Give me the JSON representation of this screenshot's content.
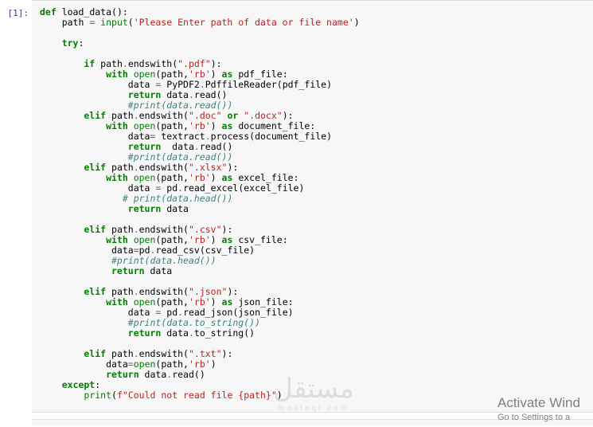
{
  "prompt": "[1]:",
  "code": {
    "l1_def": "def",
    "l1_name": " load_data",
    "l1_paren": "():",
    "l2_name": "    path ",
    "l2_eq": "=",
    "l2_input": " input",
    "l2_paren_o": "(",
    "l2_str": "'Please Enter path of data or file name'",
    "l2_paren_c": ")",
    "l4_try": "    try",
    "l4_colon": ":",
    "l6_if": "        if",
    "l6_cond": " path",
    "l6_dot": ".",
    "l6_ew": "endswith",
    "l6_po": "(",
    "l6_str": "\".pdf\"",
    "l6_pc": "):",
    "l7_with": "            with",
    "l7_open": " open",
    "l7_po": "(",
    "l7_arg1": "path,",
    "l7_str": "'rb'",
    "l7_pc": ")",
    "l7_as": " as",
    "l7_var": " pdf_file:",
    "l8_assign": "                data ",
    "l8_eq": "=",
    "l8_rhs": " PyPDF2",
    "l8_dot1": ".",
    "l8_rhs2": "PdffileReader",
    "l8_po": "(",
    "l8_arg": "pdf_file",
    "l8_pc": ")",
    "l9_ret": "                return",
    "l9_exp": " data",
    "l9_dot": ".",
    "l9_read": "read",
    "l9_par": "()",
    "l10_cm": "                #print(data.read())",
    "l11_elif": "        elif",
    "l11_cond": " path",
    "l11_dot": ".",
    "l11_ew": "endswith",
    "l11_po": "(",
    "l11_str1": "\".doc\"",
    "l11_or": " or ",
    "l11_str2": "\".docx\"",
    "l11_pc": "):",
    "l12_with": "            with",
    "l12_open": " open",
    "l12_po": "(",
    "l12_arg1": "path,",
    "l12_str": "'rb'",
    "l12_pc": ")",
    "l12_as": " as",
    "l12_var": " document_file:",
    "l13_assign": "                data",
    "l13_eq": "=",
    "l13_rhs": " textract",
    "l13_dot": ".",
    "l13_proc": "process",
    "l13_po": "(",
    "l13_arg": "document_file",
    "l13_pc": ")",
    "l14_ret": "                return",
    "l14_exp": "  data",
    "l14_dot": ".",
    "l14_read": "read",
    "l14_par": "()",
    "l15_cm": "                #print(data.read())",
    "l16_elif": "        elif",
    "l16_cond": " path",
    "l16_dot": ".",
    "l16_ew": "endswith",
    "l16_po": "(",
    "l16_str": "\".xlsx\"",
    "l16_pc": "):",
    "l17_with": "            with",
    "l17_open": " open",
    "l17_po": "(",
    "l17_arg1": "path,",
    "l17_str": "'rb'",
    "l17_pc": ")",
    "l17_as": " as",
    "l17_var": " excel_file:",
    "l18_assign": "                data ",
    "l18_eq": "=",
    "l18_rhs": " pd",
    "l18_dot": ".",
    "l18_fn": "read_excel",
    "l18_po": "(",
    "l18_arg": "excel_file",
    "l18_pc": ")",
    "l19_cm": "               # print(data.head())",
    "l20_ret": "                return",
    "l20_exp": " data",
    "l22_elif": "        elif",
    "l22_cond": " path",
    "l22_dot": ".",
    "l22_ew": "endswith",
    "l22_po": "(",
    "l22_str": "\".csv\"",
    "l22_pc": "):",
    "l23_with": "            with",
    "l23_open": " open",
    "l23_po": "(",
    "l23_arg1": "path,",
    "l23_str": "'rb'",
    "l23_pc": ")",
    "l23_as": " as",
    "l23_var": " csv_file:",
    "l24_assign": "             data",
    "l24_eq": "=",
    "l24_rhs": "pd",
    "l24_dot": ".",
    "l24_fn": "read_csv",
    "l24_po": "(",
    "l24_arg": "csv_file",
    "l24_pc": ")",
    "l25_cm": "             #print(data.head())",
    "l26_ret": "             return",
    "l26_exp": " data",
    "l28_elif": "        elif",
    "l28_cond": " path",
    "l28_dot": ".",
    "l28_ew": "endswith",
    "l28_po": "(",
    "l28_str": "\".json\"",
    "l28_pc": "):",
    "l29_with": "            with",
    "l29_open": " open",
    "l29_po": "(",
    "l29_arg1": "path,",
    "l29_str": "'rb'",
    "l29_pc": ")",
    "l29_as": " as",
    "l29_var": " json_file:",
    "l30_assign": "                data ",
    "l30_eq": "=",
    "l30_rhs": " pd",
    "l30_dot": ".",
    "l30_fn": "read_json",
    "l30_po": "(",
    "l30_arg": "json_file",
    "l30_pc": ")",
    "l31_cm": "                #print(data.to_string())",
    "l32_ret": "                return",
    "l32_exp": " data",
    "l32_dot": ".",
    "l32_fn": "to_string",
    "l32_par": "()",
    "l34_elif": "        elif",
    "l34_cond": " path",
    "l34_dot": ".",
    "l34_ew": "endswith",
    "l34_po": "(",
    "l34_str": "\".txt\"",
    "l34_pc": "):",
    "l35_assign": "            data",
    "l35_eq": "=",
    "l35_open": "open",
    "l35_po": "(",
    "l35_arg1": "path,",
    "l35_str": "'rb'",
    "l35_pc": ")",
    "l36_ret": "            return",
    "l36_exp": " data",
    "l36_dot": ".",
    "l36_fn": "read",
    "l36_par": "()",
    "l37_exc": "    except",
    "l37_colon": ":",
    "l38_print": "        print",
    "l38_po": "(",
    "l38_f": "f",
    "l38_str": "\"Could not read file {path}\"",
    "l38_pc": ")"
  },
  "watermark": {
    "big": "مستقل",
    "small": "mostaql.com"
  },
  "activate": {
    "title": "Activate Wind",
    "sub": "Go to Settings to a"
  }
}
